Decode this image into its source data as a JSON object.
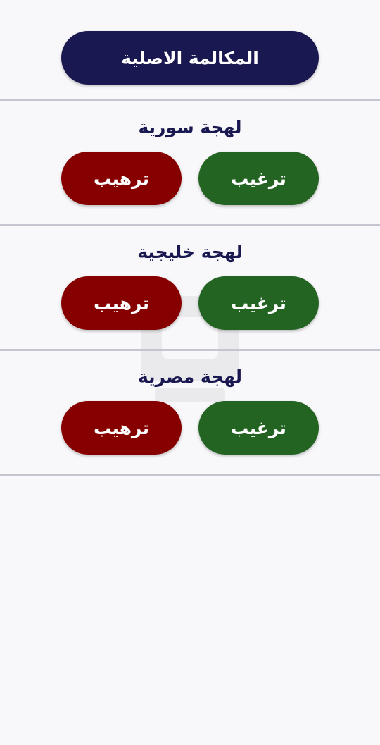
{
  "header": {
    "main_button_label": "المكالمة الاصلية"
  },
  "sections": [
    {
      "title": "لهجة سورية",
      "encourage_label": "ترغيب",
      "intimidate_label": "ترهيب"
    },
    {
      "title": "لهجة خليجية",
      "encourage_label": "ترغيب",
      "intimidate_label": "ترهيب"
    },
    {
      "title": "لهجة مصرية",
      "encourage_label": "ترغيب",
      "intimidate_label": "ترهيب"
    }
  ],
  "colors": {
    "primary_navy": "#1a1850",
    "encourage_green": "#236422",
    "intimidate_red": "#870000",
    "background": "#f8f8fa"
  }
}
